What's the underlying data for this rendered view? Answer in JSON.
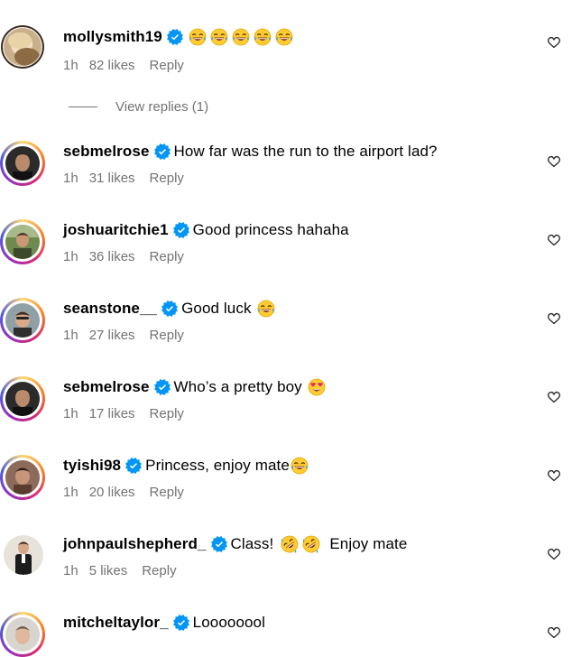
{
  "colors": {
    "verified": "#0095f6",
    "meta_text": "#737373",
    "story_ring": [
      "#feda75",
      "#fa7e1e",
      "#d62976",
      "#962fbf",
      "#4f5bd5"
    ]
  },
  "comments": [
    {
      "username": "mollysmith19",
      "verified": true,
      "text": "",
      "emojis": [
        "tears-of-joy",
        "tears-of-joy",
        "tears-of-joy",
        "tears-of-joy",
        "tears-of-joy"
      ],
      "time": "1h",
      "likes": "82 likes",
      "reply": "Reply",
      "view_replies": "View replies (1)"
    },
    {
      "username": "sebmelrose",
      "verified": true,
      "text": "How far was the run to the airport lad?",
      "emojis": [],
      "time": "1h",
      "likes": "31 likes",
      "reply": "Reply"
    },
    {
      "username": "joshuaritchie1",
      "verified": true,
      "text": "Good princess hahaha",
      "emojis": [],
      "time": "1h",
      "likes": "36 likes",
      "reply": "Reply"
    },
    {
      "username": "seanstone__",
      "verified": true,
      "text": "Good luck",
      "emojis": [
        "tears-of-joy"
      ],
      "time": "1h",
      "likes": "27 likes",
      "reply": "Reply"
    },
    {
      "username": "sebmelrose",
      "verified": true,
      "text": "Who’s a pretty boy",
      "emojis": [
        "heart-eyes"
      ],
      "time": "1h",
      "likes": "17 likes",
      "reply": "Reply"
    },
    {
      "username": "tyishi98",
      "verified": true,
      "text": "Princess, enjoy mate",
      "emojis": [
        "tears-of-joy"
      ],
      "time": "1h",
      "likes": "20 likes",
      "reply": "Reply"
    },
    {
      "username": "johnpaulshepherd_",
      "verified": true,
      "text": "Class!",
      "text_after": "Enjoy mate",
      "emojis": [
        "rofl",
        "rofl"
      ],
      "time": "1h",
      "likes": "5 likes",
      "reply": "Reply"
    },
    {
      "username": "mitcheltaylor_",
      "verified": true,
      "text": "Loooooool",
      "emojis": [],
      "time": "",
      "likes": "",
      "reply": ""
    }
  ]
}
